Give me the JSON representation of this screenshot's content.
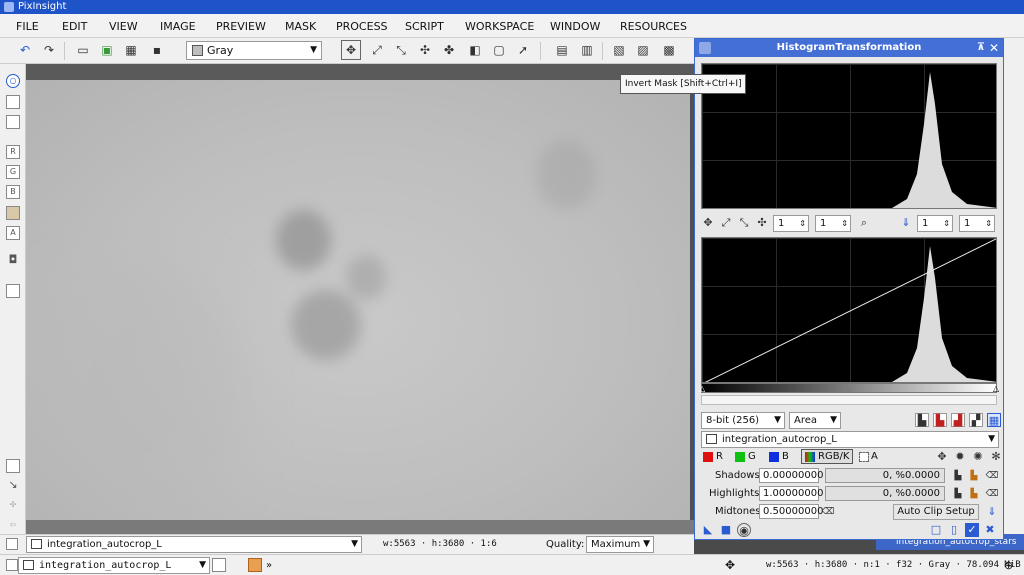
{
  "app": {
    "title": "PixInsight"
  },
  "menu": [
    "FILE",
    "EDIT",
    "VIEW",
    "IMAGE",
    "PREVIEW",
    "MASK",
    "PROCESS",
    "SCRIPT",
    "WORKSPACE",
    "WINDOW",
    "RESOURCES"
  ],
  "toolbar": {
    "color_mode": "Gray"
  },
  "tooltip": "Invert Mask [Shift+Ctrl+I]",
  "left_channels": [
    "R",
    "G",
    "B",
    "A"
  ],
  "image_window": {
    "view_select": "integration_autocrop_L",
    "dims": "w:5563 · h:3680 · 1:6",
    "quality_label": "Quality:",
    "quality_value": "Maximum"
  },
  "status": {
    "view_select": "integration_autocrop_L",
    "more": "»",
    "info": "w:5563 · h:3680 · n:1 · f32 · Gray · 78.094 MiB ·"
  },
  "star_window": "integration_autocrop_stars",
  "histogram": {
    "title": "HistogramTransformation",
    "zoom_x": "1",
    "zoom_y": "1",
    "zoom_x2": "1",
    "zoom_y2": "1",
    "resolution": "8-bit (256)",
    "plot_mode": "Area",
    "view": "integration_autocrop_L",
    "channels": [
      "R",
      "G",
      "B",
      "RGB/K",
      "A"
    ],
    "channel_colors": [
      "#e01010",
      "#10c010",
      "#1030e0",
      "#888888",
      "#ffffff"
    ],
    "shadows_label": "Shadows:",
    "shadows_value": "0.00000000",
    "shadows_clip": "0, %0.0000",
    "highlights_label": "Highlights:",
    "highlights_value": "1.00000000",
    "highlights_clip": "0, %0.0000",
    "midtones_label": "Midtones:",
    "midtones_value": "0.50000000",
    "auto_clip_label": "Auto Clip Setup"
  }
}
